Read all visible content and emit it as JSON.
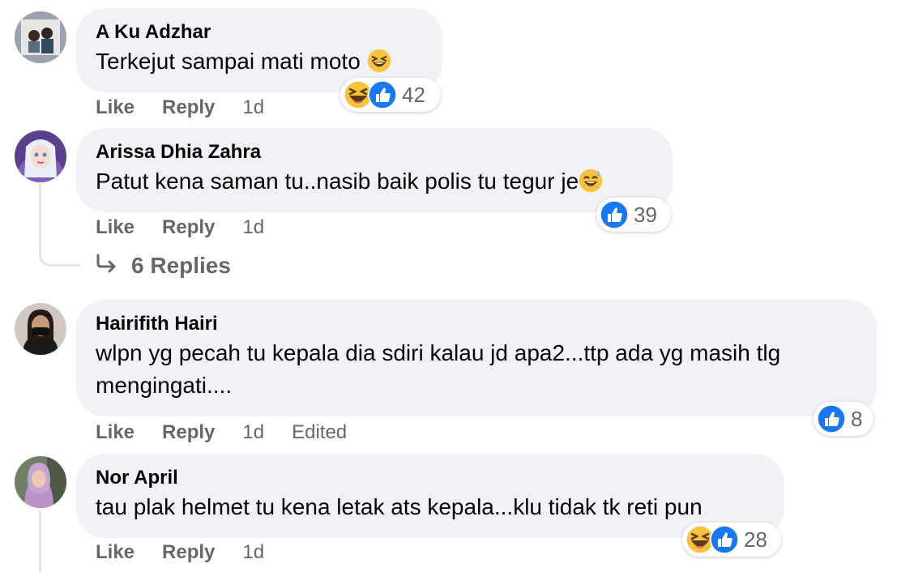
{
  "comments": [
    {
      "author": "A Ku Adzhar",
      "text": "Terkejut sampai mati moto",
      "like_label": "Like",
      "reply_label": "Reply",
      "time": "1d",
      "reactions": [
        "haha",
        "like"
      ],
      "reaction_count": "42"
    },
    {
      "author": "Arissa Dhia Zahra",
      "text": "Patut kena saman tu..nasib baik polis tu tegur je",
      "like_label": "Like",
      "reply_label": "Reply",
      "time": "1d",
      "reactions": [
        "like"
      ],
      "reaction_count": "39",
      "replies_label": "6 Replies"
    },
    {
      "author": "Hairifith Hairi",
      "text_line1": "wlpn yg pecah tu kepala dia sdiri kalau jd apa2...ttp ada yg masih tlg",
      "text_line2": "mengingati....",
      "like_label": "Like",
      "reply_label": "Reply",
      "time": "1d",
      "edited": "Edited",
      "reactions": [
        "like"
      ],
      "reaction_count": "8"
    },
    {
      "author": "Nor April",
      "text": "tau plak helmet tu kena letak ats kepala...klu tidak tk reti pun",
      "like_label": "Like",
      "reply_label": "Reply",
      "time": "1d",
      "reactions": [
        "haha",
        "like"
      ],
      "reaction_count": "28"
    }
  ],
  "colors": {
    "bubble": "#f0f2f5",
    "meta_text": "#65676b",
    "like_blue": "#1877f2",
    "haha_yellow": "#f7c23c"
  }
}
